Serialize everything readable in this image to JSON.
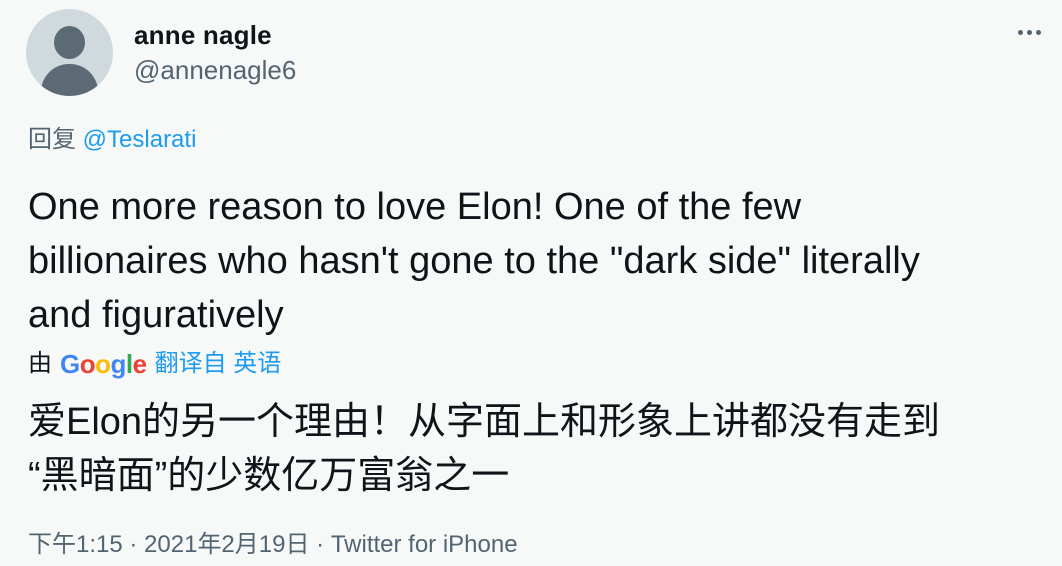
{
  "user": {
    "display_name": "anne nagle",
    "handle": "@annenagle6"
  },
  "reply": {
    "prefix": "回复",
    "mention": "@Teslarati"
  },
  "tweet": {
    "text_line1": "One more reason to love Elon! One of the few",
    "text_line2": "billionaires who hasn't gone to the \"dark side\" literally",
    "text_line3": "and figuratively"
  },
  "translation": {
    "by": "由",
    "google_letters": [
      "G",
      "o",
      "o",
      "g",
      "l",
      "e"
    ],
    "translated_from": "翻译自",
    "language": "英语",
    "text_line1": "爱Elon的另一个理由！从字面上和形象上讲都没有走到",
    "text_line2": "“黑暗面”的少数亿万富翁之一"
  },
  "meta": {
    "time": "下午1:15",
    "separator1": " · ",
    "date": "2021年2月19日",
    "separator2": " · ",
    "source": "Twitter for iPhone"
  },
  "icons": {
    "more": "more-dots-icon",
    "avatar": "default-avatar-icon"
  },
  "colors": {
    "link": "#1d9bf0",
    "secondary_text": "#536471",
    "primary_text": "#0f1419",
    "background": "#f7f9f9"
  }
}
